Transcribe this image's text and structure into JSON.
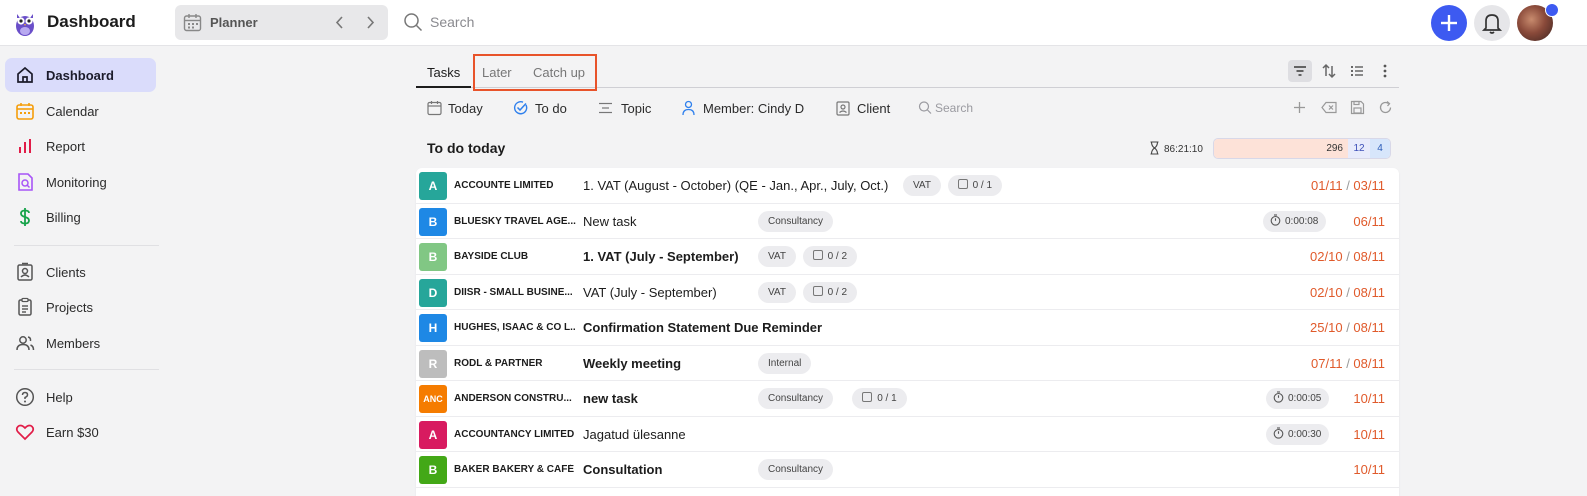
{
  "header": {
    "app_title": "Dashboard",
    "planner_label": "Planner",
    "search_placeholder": "Search",
    "colors": {
      "accent": "#3d5af1",
      "brand": "#5b5bd6"
    }
  },
  "sidebar": {
    "items": [
      {
        "label": "Dashboard",
        "icon": "home-icon",
        "active": true
      },
      {
        "label": "Calendar",
        "icon": "calendar-icon"
      },
      {
        "label": "Report",
        "icon": "bar-chart-icon"
      },
      {
        "label": "Monitoring",
        "icon": "monitoring-icon"
      },
      {
        "label": "Billing",
        "icon": "dollar-icon"
      },
      {
        "label": "Clients",
        "icon": "clients-icon"
      },
      {
        "label": "Projects",
        "icon": "clipboard-icon"
      },
      {
        "label": "Members",
        "icon": "members-icon"
      },
      {
        "label": "Help",
        "icon": "help-icon"
      },
      {
        "label": "Earn $30",
        "icon": "heart-icon"
      }
    ]
  },
  "tabs": [
    {
      "label": "Tasks",
      "active": true
    },
    {
      "label": "Later"
    },
    {
      "label": "Catch up"
    }
  ],
  "filters": {
    "today": "Today",
    "todo": "To do",
    "topic": "Topic",
    "member": "Member: Cindy D",
    "client": "Client",
    "search_placeholder": "Search"
  },
  "section": {
    "title": "To do today",
    "total_time": "86:21:10",
    "counts": [
      "296",
      "12",
      "4"
    ]
  },
  "tasks": [
    {
      "badge": "A",
      "badge_color": "#26a69a",
      "client": "ACCOUNTE LIMITED",
      "title": "1. VAT (August - October) (QE - Jan., Apr., July, Oct.)",
      "bold": false,
      "chips": [
        "VAT"
      ],
      "checklist": "0 / 1",
      "timer": "",
      "date_start": "01/11",
      "date_end": "03/11"
    },
    {
      "badge": "B",
      "badge_color": "#1e88e5",
      "client": "BLUESKY TRAVEL AGE...",
      "title": "New task",
      "bold": false,
      "chips": [
        "Consultancy"
      ],
      "checklist": "",
      "timer": "0:00:08",
      "date_start": "",
      "date_end": "06/11"
    },
    {
      "badge": "B",
      "badge_color": "#81c784",
      "client": "BAYSIDE CLUB",
      "title": "1. VAT (July - September)",
      "bold": true,
      "chips": [
        "VAT"
      ],
      "checklist": "0 / 2",
      "timer": "",
      "date_start": "02/10",
      "date_end": "08/11"
    },
    {
      "badge": "D",
      "badge_color": "#26a69a",
      "client": "DIISR - SMALL BUSINE...",
      "title": "VAT (July - September)",
      "bold": false,
      "chips": [
        "VAT"
      ],
      "checklist": "0 / 2",
      "timer": "",
      "date_start": "02/10",
      "date_end": "08/11"
    },
    {
      "badge": "H",
      "badge_color": "#1e88e5",
      "client": "HUGHES, ISAAC & CO L...",
      "title": "Confirmation Statement Due Reminder",
      "bold": true,
      "chips": [],
      "checklist": "",
      "timer": "",
      "date_start": "25/10",
      "date_end": "08/11"
    },
    {
      "badge": "R",
      "badge_color": "#bdbdbd",
      "client": "RÖDL & PARTNER",
      "title": "Weekly meeting",
      "bold": true,
      "chips": [
        "Internal"
      ],
      "checklist": "",
      "timer": "",
      "date_start": "07/11",
      "date_end": "08/11"
    },
    {
      "badge": "ANC",
      "badge_color": "#f57c00",
      "client": "ANDERSON CONSTRU...",
      "title": "new task",
      "bold": true,
      "chips": [
        "Consultancy"
      ],
      "checklist": "0 / 1",
      "timer": "0:00:05",
      "date_start": "",
      "date_end": "10/11"
    },
    {
      "badge": "A",
      "badge_color": "#d81b60",
      "client": "ACCOUNTANCY LIMITED",
      "title": "Jagatud ülesanne",
      "bold": false,
      "chips": [],
      "checklist": "",
      "timer": "0:00:30",
      "date_start": "",
      "date_end": "10/11"
    },
    {
      "badge": "B",
      "badge_color": "#43a817",
      "client": "BAKER BAKERY & CAFÉ",
      "title": "Consultation",
      "bold": true,
      "chips": [
        "Consultancy"
      ],
      "checklist": "",
      "timer": "",
      "date_start": "",
      "date_end": "10/11"
    }
  ]
}
